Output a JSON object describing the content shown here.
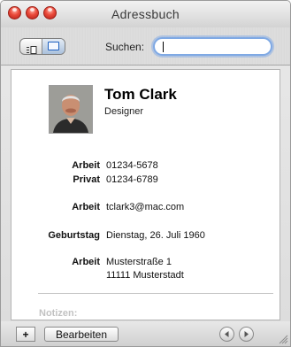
{
  "window": {
    "title": "Adressbuch"
  },
  "toolbar": {
    "search_label": "Suchen:",
    "search_value": ""
  },
  "card": {
    "name": "Tom Clark",
    "job_title": "Designer",
    "phones": [
      {
        "label": "Arbeit",
        "value": "01234-5678"
      },
      {
        "label": "Privat",
        "value": "01234-6789"
      }
    ],
    "email": {
      "label": "Arbeit",
      "value": "tclark3@mac.com"
    },
    "birthday": {
      "label": "Geburtstag",
      "value": "Dienstag, 26. Juli 1960"
    },
    "address": {
      "label": "Arbeit",
      "street": "Musterstraße 1",
      "city": "11111 Musterstadt"
    },
    "notes_label": "Notizen:"
  },
  "bottombar": {
    "add_label": "+",
    "edit_label": "Bearbeiten"
  },
  "icons": {
    "close": "close-button-red",
    "minimize": "minimize-button",
    "zoom": "zoom-button",
    "column_view": "column-view-icon",
    "card_view": "card-view-icon",
    "prev": "left-arrow-icon",
    "next": "right-arrow-icon",
    "resize": "resize-grip-icon"
  },
  "colors": {
    "traffic_light": "#e2453a",
    "search_focus": "#7fa9e4",
    "card_icon": "#1c5fbf"
  }
}
